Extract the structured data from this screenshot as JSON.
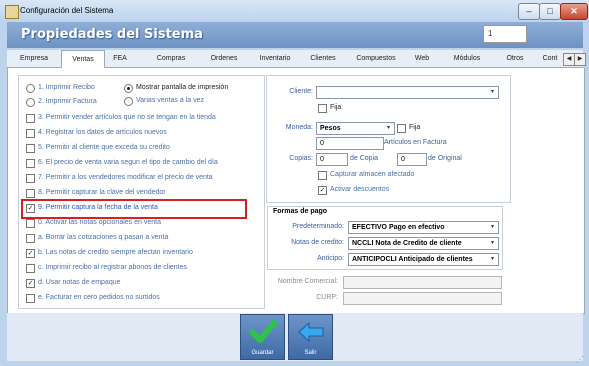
{
  "window": {
    "title": "Configuración del Sistema"
  },
  "header": {
    "title": "Propiedades del Sistema",
    "counter": "1"
  },
  "tabs": [
    "Empresa",
    "Ventas",
    "FEA",
    "Compras",
    "Ordenes",
    "Inventario",
    "Clientes",
    "Compuestos",
    "Web",
    "Módulos",
    "Otros",
    "Cont"
  ],
  "active_tab": "Ventas",
  "left_options": [
    {
      "type": "radio",
      "checked": false,
      "label": "1. Imprimir Recibo"
    },
    {
      "type": "radio",
      "checked": false,
      "label": "2. Imprimir Factura"
    },
    {
      "type": "check",
      "checked": false,
      "label": "3. Permitir vender artículos que no se tengan en la tienda"
    },
    {
      "type": "check",
      "checked": false,
      "label": "4. Registrar los datos de artículos nuevos"
    },
    {
      "type": "check",
      "checked": false,
      "label": "5. Permitir al cliente que exceda su credito"
    },
    {
      "type": "check",
      "checked": false,
      "label": "6. El precio de venta varia segun el tipo de cambio del día"
    },
    {
      "type": "check",
      "checked": false,
      "label": "7. Permitir a los vendedores modificar el precio de venta"
    },
    {
      "type": "check",
      "checked": false,
      "label": "8. Permitir capturar la clave del vendedor"
    },
    {
      "type": "check",
      "checked": true,
      "label": "9. Permitir captura la fecha de la venta"
    },
    {
      "type": "check",
      "checked": false,
      "label": "0. Activar las notas opcionales en venta"
    },
    {
      "type": "check",
      "checked": false,
      "label": "a. Borrar las cotizaciones q pasan a venta"
    },
    {
      "type": "check",
      "checked": true,
      "label": "b. Las notas de credito siempre afectan inventario"
    },
    {
      "type": "check",
      "checked": false,
      "label": "c. Imprimir recibo al registrar abonos de clientes"
    },
    {
      "type": "check",
      "checked": true,
      "label": "d. Usar notas de empaque"
    },
    {
      "type": "check",
      "checked": false,
      "label": "e. Facturar en cero pedidos no surtidos"
    }
  ],
  "print_mode": {
    "show_screen": {
      "checked": true,
      "label": "Mostrar pantalla de impresión"
    },
    "multi_sales": {
      "checked": false,
      "label": "Varias ventas a la vez"
    }
  },
  "right": {
    "cliente_label": "Cliente:",
    "cliente_value": "",
    "fija_1": "Fija",
    "moneda_label": "Moneda:",
    "moneda_value": "Pesos",
    "fija_2": "Fija",
    "articulos_value": "0",
    "articulos_label": "Artículos en Factura",
    "copias_label": "Copias:",
    "copias_value": "0",
    "de_copia_label": "de Copia",
    "original_value": "0",
    "de_original_label": "de Original",
    "capturar_almacen": {
      "checked": false,
      "label": "Capturar almacen afectado"
    },
    "activar_descuentos": {
      "checked": true,
      "label": "Activar descuentos"
    }
  },
  "payments": {
    "legend": "Formas de pago",
    "rows": [
      {
        "label": "Predeterminado:",
        "value": "EFECTIVO Pago en efectivo"
      },
      {
        "label": "Notas de credito:",
        "value": "NCCLI Nota de Credito de cliente"
      },
      {
        "label": "Anticipo:",
        "value": "ANTICIPOCLI Anticipado de clientes"
      }
    ]
  },
  "extra": {
    "nombre_comercial_label": "Nombre Comercial:",
    "nombre_comercial_value": "",
    "curp_label": "CURP:",
    "curp_value": ""
  },
  "buttons": {
    "save": "Guardar",
    "exit": "Salir"
  },
  "colors": {
    "highlight": "#d9201e",
    "header": "#7a9cca",
    "link_text": "#3a5f9c"
  }
}
